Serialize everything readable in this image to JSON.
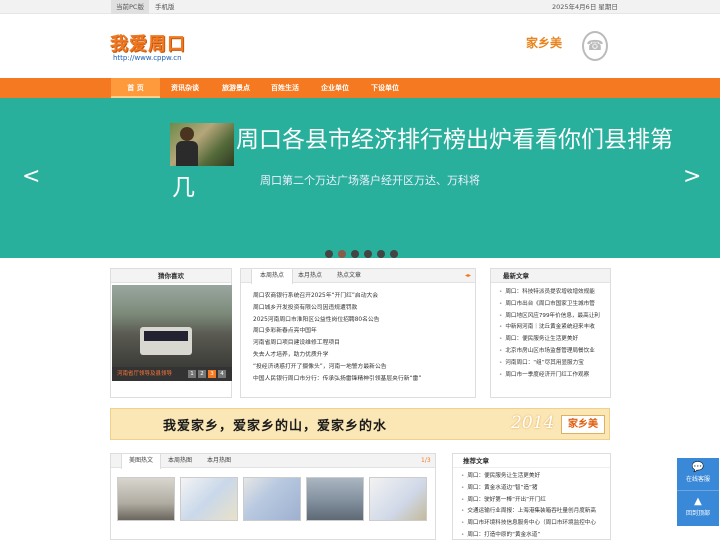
{
  "topbar": {
    "pc_label": "当前PC版",
    "mobile_label": "手机版",
    "date": "2025年4月6日 星期日"
  },
  "header": {
    "logo": "我爱周口",
    "url": "http://www.cppw.cn",
    "brand": "家乡美",
    "brand_icon": "phone-icon"
  },
  "nav": {
    "items": [
      {
        "label": "首 页",
        "active": true
      },
      {
        "label": "资讯杂谈"
      },
      {
        "label": "旅游景点"
      },
      {
        "label": "百姓生活"
      },
      {
        "label": "企业单位"
      },
      {
        "label": "下设单位"
      }
    ]
  },
  "banner": {
    "headline_line1": "周口各县市经济排行榜出炉看看你们县排第",
    "headline_line2": "几",
    "subtitle": "周口第二个万达广场落户经开区万达、万科将",
    "prev": "<",
    "next": ">",
    "slide_count": 6,
    "active_slide": 2
  },
  "guess": {
    "title": "猜你喜欢",
    "caption": "河南省厅领导及县领导",
    "pages": [
      "1",
      "2",
      "3",
      "4"
    ],
    "active_page": 3
  },
  "hot": {
    "tabs": [
      "本周热点",
      "本月热点",
      "热点文章"
    ],
    "items": [
      "周口农商银行系统召开2025年“开门红”启动大会",
      "周口城乡开发投资有限公司因违规遭罚款",
      "2025河南周口市淮阳区公益性岗位招聘80名公告",
      "周口多彩新春点亮中国年",
      "河南省周口项目建设维修工程项目",
      "失去人才培养，助力优质升学",
      "“投经济诱惑打开了摄像头”，河南一地警方最新公告",
      "中国人民银行周口市分行：传承弘扬雷锋精神引领基层央行新“雷”"
    ]
  },
  "latest": {
    "title": "最新文章",
    "items": [
      "周口：科技特派员提农增收增效规能",
      "周口市出台《周口市国家卫生城市管",
      "周口地区风应799年价信息，最高让利",
      "中新网河南｜沈丘黄金紧统迎来丰收",
      "周口：便民服务让生活更美好",
      "北京市房山区市场监督管理局餐饮业",
      "河南周口：“组”尽其用显服力宝",
      "周口市一季度经济开门红工作观察"
    ]
  },
  "slogan": {
    "text": "我爱家乡，爱家乡的山，爱家乡的水",
    "year": "2014",
    "brand": "家乡美"
  },
  "pics": {
    "tabs": [
      "美图热文",
      "本周热图",
      "本月热图"
    ],
    "page": "1/3"
  },
  "recommend": {
    "title": "推荐文章",
    "items": [
      "周口：便民服务让生活更美好",
      "周口：黄金水道边“智”造”猪",
      "周口：驶好第一棒“开出”开门红",
      "交通运输行业周报：上海港集装箱吞吐量创月度新高",
      "周口市环境科技信息服务中心（周口市环境监控中心",
      "周口：打造中原的“黄金水道”"
    ]
  },
  "sidebar": {
    "consult": "在线客服",
    "back_top": "回到顶部"
  }
}
